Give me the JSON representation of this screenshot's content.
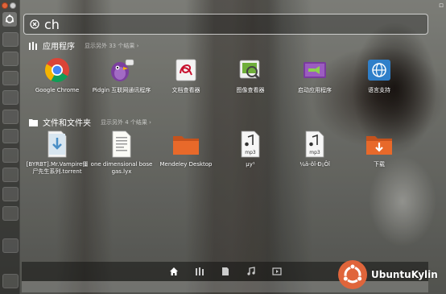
{
  "search": {
    "query": "ch"
  },
  "apps": {
    "title": "应用程序",
    "more": "显示另外 33 个结果 ›",
    "items": [
      {
        "label": "Google Chrome",
        "icon": "chrome-icon"
      },
      {
        "label": "Pidgin 互联网通讯程序",
        "icon": "pidgin-icon"
      },
      {
        "label": "文档查看器",
        "icon": "document-viewer-icon"
      },
      {
        "label": "图像查看器",
        "icon": "image-viewer-icon"
      },
      {
        "label": "启动应用程序",
        "icon": "startup-apps-icon"
      },
      {
        "label": "语言支持",
        "icon": "language-support-icon"
      }
    ]
  },
  "files": {
    "title": "文件和文件夹",
    "more": "显示另外 4 个结果 ›",
    "items": [
      {
        "label": "[BYRBT].Mr.Vampire僵尸先生系列.torrent",
        "icon": "torrent-file-icon"
      },
      {
        "label": "one dimensional bose gas.lyx",
        "icon": "lyx-document-icon"
      },
      {
        "label": "Mendeley Desktop",
        "icon": "folder-icon"
      },
      {
        "label": "µy¹ ",
        "icon": "mp3-file-icon"
      },
      {
        "label": "¼ä-õî·Ð¡Ôî",
        "icon": "mp3-file-icon"
      },
      {
        "label": "下载",
        "icon": "downloads-folder-icon"
      }
    ]
  },
  "lenses": [
    "home-lens-icon",
    "applications-lens-icon",
    "files-lens-icon",
    "music-lens-icon",
    "video-lens-icon"
  ],
  "watermark": {
    "text": "UbuntuKylin"
  },
  "colors": {
    "accent_orange": "#e0653b",
    "folder_orange": "#e8692a",
    "chrome_red": "#db4437",
    "chrome_green": "#0f9d58",
    "chrome_yellow": "#f4b400",
    "chrome_blue": "#4285f4"
  }
}
